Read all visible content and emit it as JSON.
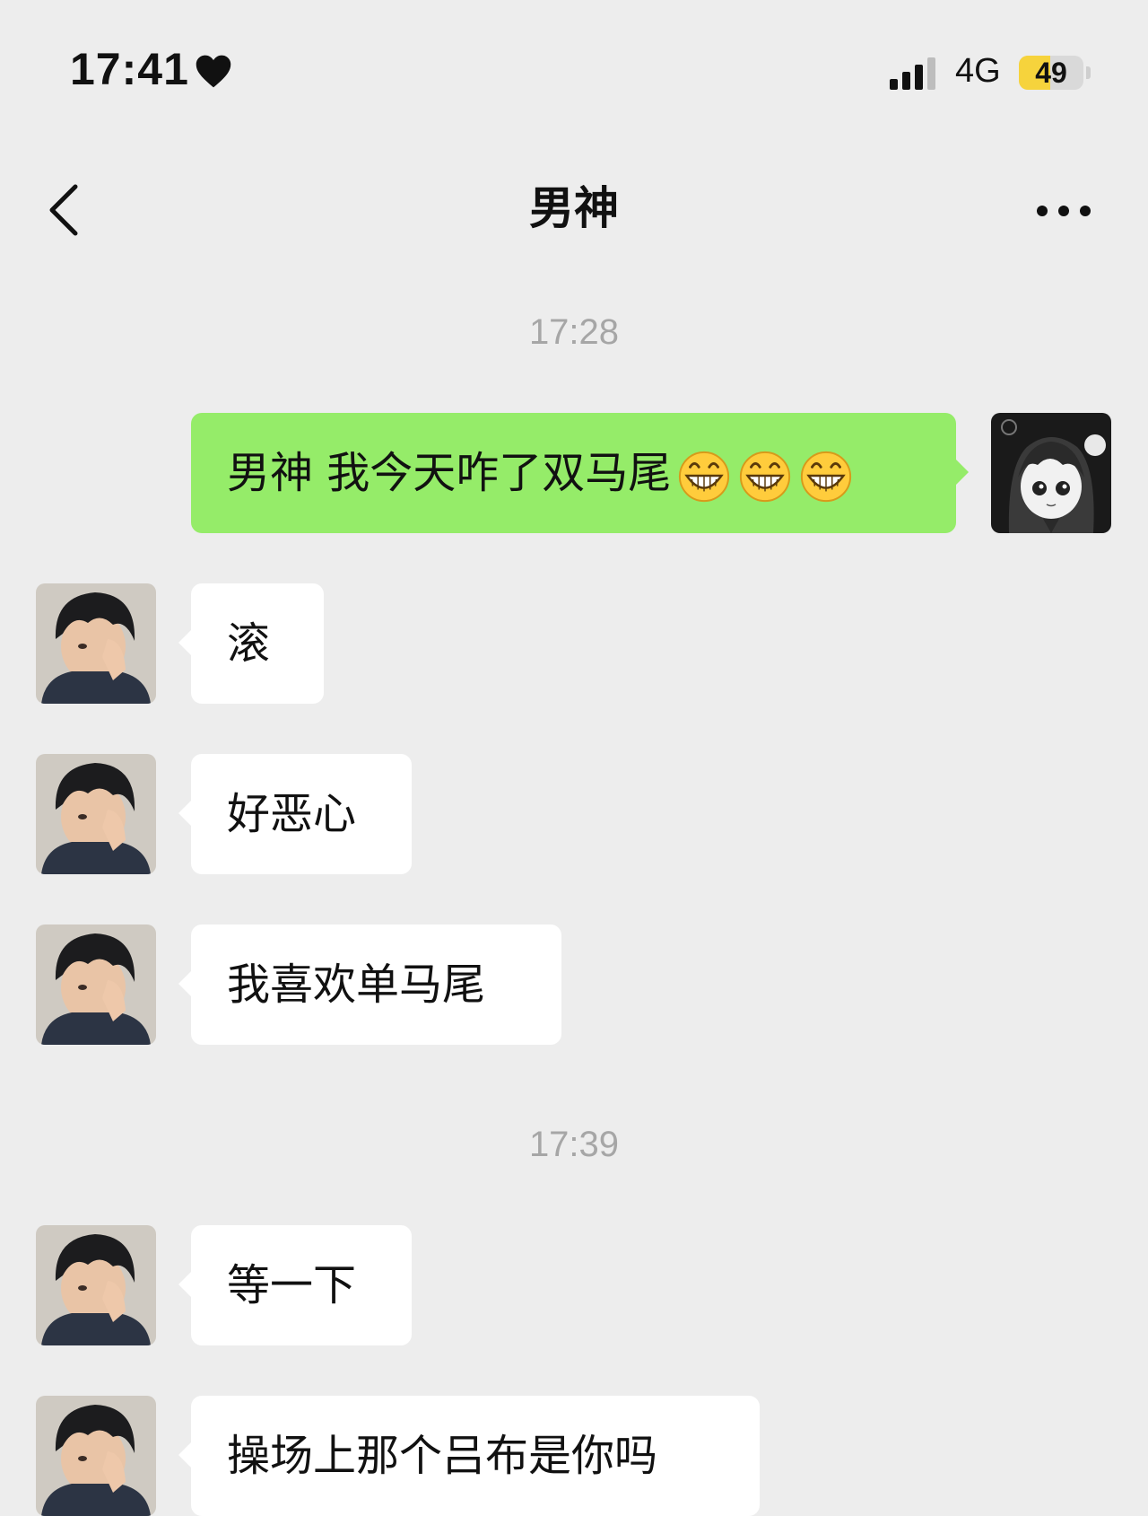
{
  "status_bar": {
    "time": "17:41",
    "heart_icon": "heart-icon",
    "signal_icon": "signal-icon",
    "network": "4G",
    "battery": "49",
    "battery_level": 0.49
  },
  "nav": {
    "title": "男神",
    "back_icon": "chevron-left-icon",
    "more_icon": "more-dots-icon"
  },
  "messages": {
    "ts1": "17:28",
    "m1": "男神 我今天咋了双马尾",
    "m2": "滚",
    "m3": "好恶心",
    "m4": "我喜欢单马尾",
    "ts2": "17:39",
    "m5": "等一下",
    "m6": "操场上那个吕布是你吗"
  },
  "colors": {
    "background": "#ededed",
    "outgoing_bubble": "#95ec69",
    "incoming_bubble": "#ffffff",
    "timestamp": "#a6a6a6",
    "battery_fill": "#f6d33c"
  }
}
